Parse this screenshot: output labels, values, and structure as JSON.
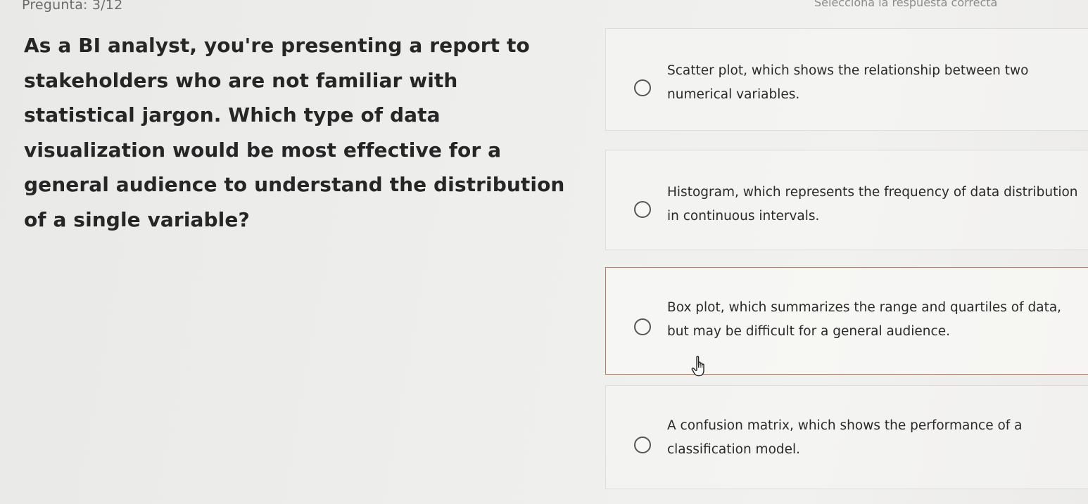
{
  "header": {
    "question_counter": "Pregunta: 3/12",
    "instruction": "Selecciona la respuesta correcta"
  },
  "question": {
    "text": "As a BI analyst, you're presenting a report to stakeholders who are not familiar with statistical jargon. Which type of data visualization would be most effective for a general audience to understand the distribution of a single variable?"
  },
  "options": [
    {
      "text": "Scatter plot, which shows the relationship between two numerical variables.",
      "selected": false
    },
    {
      "text": "Histogram, which represents the frequency of data distribution in continuous intervals.",
      "selected": false
    },
    {
      "text": "Box plot, which summarizes the range and quartiles of data, but may be difficult for a general audience.",
      "selected": false,
      "hovered": true
    },
    {
      "text": "A confusion matrix, which shows the performance of a classification model.",
      "selected": false
    }
  ],
  "colors": {
    "hover_border": "#c27a59",
    "option_border": "#dcdcda",
    "question_text": "#262626",
    "radio_border": "#555555"
  },
  "icons": {
    "radio": "radio-unselected-icon",
    "cursor": "hand-pointer-icon"
  }
}
